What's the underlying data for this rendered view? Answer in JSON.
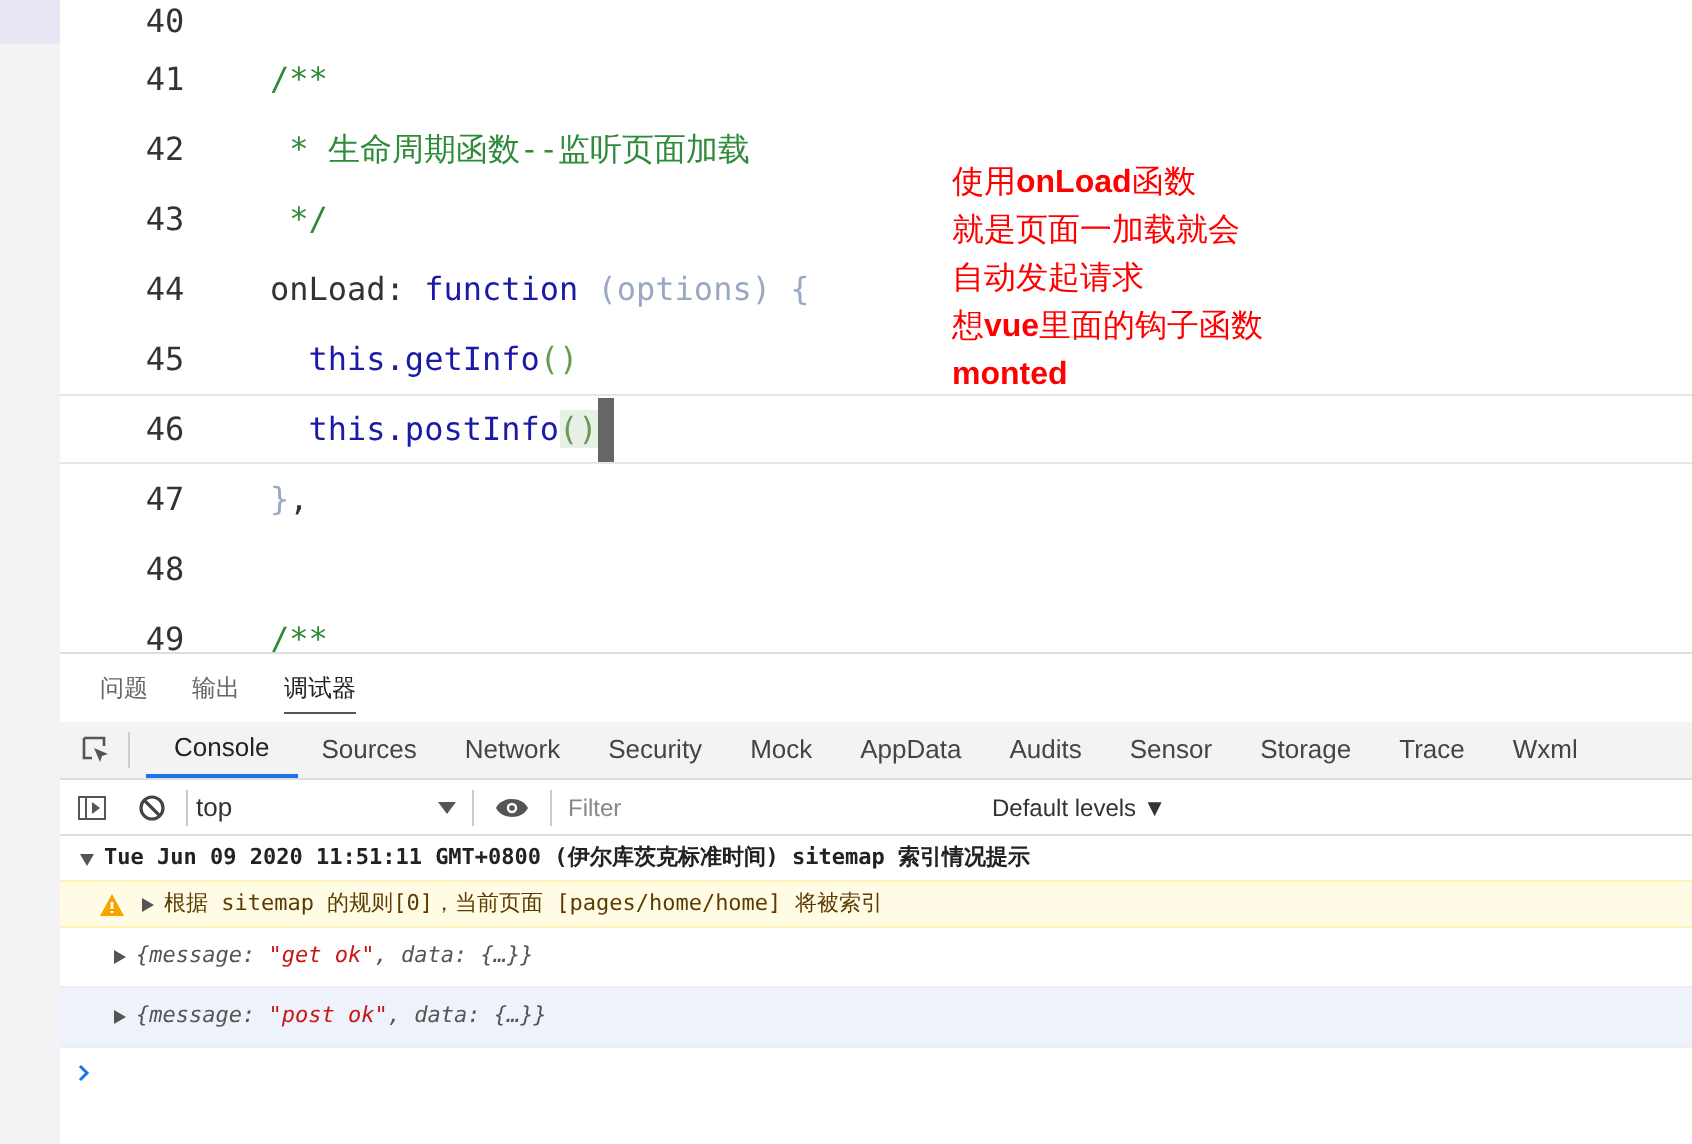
{
  "editor": {
    "lines": [
      {
        "number": "40"
      },
      {
        "number": "41",
        "tokens": [
          {
            "text": "/**",
            "kind": "comment"
          }
        ]
      },
      {
        "number": "42",
        "tokens": [
          {
            "text": " * 生命周期函数--监听页面加载",
            "kind": "comment"
          }
        ]
      },
      {
        "number": "43",
        "tokens": [
          {
            "text": " */",
            "kind": "comment"
          }
        ]
      },
      {
        "number": "44",
        "tokens": [
          {
            "text": "onLoad: ",
            "kind": "plain"
          },
          {
            "text": "function ",
            "kind": "keyword"
          },
          {
            "text": "(options) {",
            "kind": "param"
          }
        ]
      },
      {
        "number": "45",
        "tokens": [
          {
            "text": "  this.getInfo",
            "kind": "keyword"
          },
          {
            "text": "()",
            "kind": "bracket"
          }
        ]
      },
      {
        "number": "46",
        "tokens": [
          {
            "text": "  this.postInfo",
            "kind": "keyword"
          },
          {
            "text": "()",
            "kind": "bracket"
          }
        ],
        "cursor": true
      },
      {
        "number": "47",
        "tokens": [
          {
            "text": "}",
            "kind": "param"
          },
          {
            "text": ",",
            "kind": "plain"
          }
        ]
      },
      {
        "number": "48"
      },
      {
        "number": "49",
        "tokens": [
          {
            "text": "/**",
            "kind": "comment"
          }
        ]
      }
    ]
  },
  "annotation": [
    "使用**onLoad**函数",
    "就是页面一加载就会",
    "自动发起请求",
    "想**vue**里面的钩子函数",
    "**monted**"
  ],
  "panel_tabs": [
    {
      "label": "问题",
      "selected": false
    },
    {
      "label": "输出",
      "selected": false
    },
    {
      "label": "调试器",
      "selected": true
    }
  ],
  "devtools_tabs": [
    {
      "label": "Console",
      "selected": true
    },
    {
      "label": "Sources",
      "selected": false
    },
    {
      "label": "Network",
      "selected": false
    },
    {
      "label": "Security",
      "selected": false
    },
    {
      "label": "Mock",
      "selected": false
    },
    {
      "label": "AppData",
      "selected": false
    },
    {
      "label": "Audits",
      "selected": false
    },
    {
      "label": "Sensor",
      "selected": false
    },
    {
      "label": "Storage",
      "selected": false
    },
    {
      "label": "Trace",
      "selected": false
    },
    {
      "label": "Wxml",
      "selected": false
    }
  ],
  "toolbar": {
    "context": "top",
    "filter_placeholder": "Filter",
    "levels": "Default levels ▼"
  },
  "console": [
    {
      "kind": "group",
      "expanded": true,
      "text": "Tue Jun 09 2020 11:51:11 GMT+0800 (伊尔库茨克标准时间) sitemap 索引情况提示"
    },
    {
      "kind": "warning",
      "expanded": false,
      "text": "根据 sitemap 的规则[0]，当前页面 [pages/home/home] 将被索引"
    },
    {
      "kind": "object",
      "expanded": false,
      "hovered": false,
      "parts": [
        {
          "text": "{message: ",
          "kind": "key"
        },
        {
          "text": "\"get ok\"",
          "kind": "string"
        },
        {
          "text": ", data: {…}}",
          "kind": "key"
        }
      ]
    },
    {
      "kind": "object",
      "expanded": false,
      "hovered": true,
      "parts": [
        {
          "text": "{message: ",
          "kind": "key"
        },
        {
          "text": "\"post ok\"",
          "kind": "string"
        },
        {
          "text": ", data: {…}}",
          "kind": "key"
        }
      ]
    }
  ]
}
